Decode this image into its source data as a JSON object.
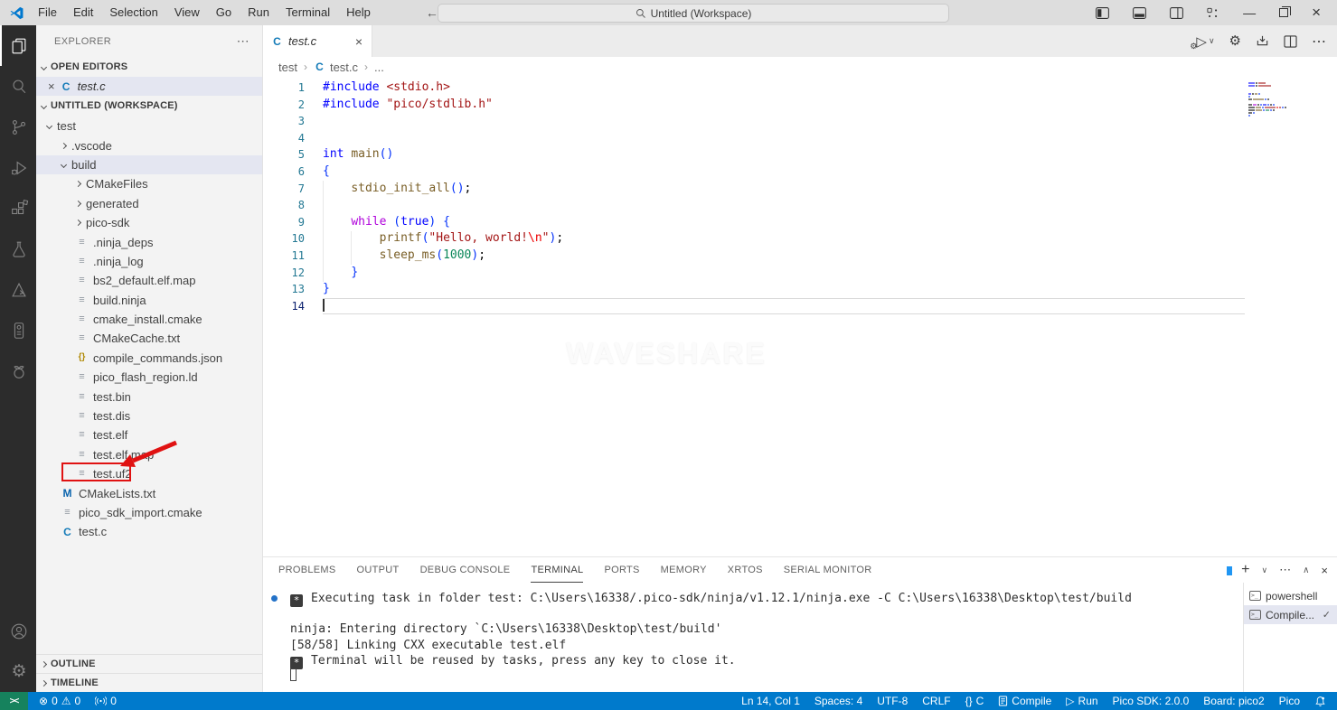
{
  "window": {
    "title_menus": [
      "File",
      "Edit",
      "Selection",
      "View",
      "Go",
      "Run",
      "Terminal",
      "Help"
    ],
    "search_label": "Untitled (Workspace)"
  },
  "activity_bar": {
    "items": [
      {
        "name": "explorer",
        "active": true
      },
      {
        "name": "search"
      },
      {
        "name": "source-control"
      },
      {
        "name": "run-and-debug"
      },
      {
        "name": "extensions"
      },
      {
        "name": "testing"
      },
      {
        "name": "cmake"
      },
      {
        "name": "pico-board"
      },
      {
        "name": "raspberry-pi-pico"
      }
    ],
    "bottom": [
      {
        "name": "accounts"
      },
      {
        "name": "settings"
      }
    ]
  },
  "sidebar": {
    "title": "EXPLORER",
    "sections": {
      "open_editors": "OPEN EDITORS",
      "workspace": "UNTITLED (WORKSPACE)",
      "outline": "OUTLINE",
      "timeline": "TIMELINE"
    },
    "open_editor_items": [
      {
        "label": "test.c",
        "icon": "c"
      }
    ],
    "tree": [
      {
        "label": "test",
        "type": "folder-open",
        "level": 0
      },
      {
        "label": ".vscode",
        "type": "folder",
        "level": 1
      },
      {
        "label": "build",
        "type": "folder-open",
        "level": 1,
        "selected": true
      },
      {
        "label": "CMakeFiles",
        "type": "folder",
        "level": 2
      },
      {
        "label": "generated",
        "type": "folder",
        "level": 2
      },
      {
        "label": "pico-sdk",
        "type": "folder",
        "level": 2
      },
      {
        "label": ".ninja_deps",
        "type": "file",
        "level": 2
      },
      {
        "label": ".ninja_log",
        "type": "file",
        "level": 2
      },
      {
        "label": "bs2_default.elf.map",
        "type": "file",
        "level": 2
      },
      {
        "label": "build.ninja",
        "type": "file",
        "level": 2
      },
      {
        "label": "cmake_install.cmake",
        "type": "file",
        "level": 2
      },
      {
        "label": "CMakeCache.txt",
        "type": "file",
        "level": 2
      },
      {
        "label": "compile_commands.json",
        "type": "json",
        "level": 2
      },
      {
        "label": "pico_flash_region.ld",
        "type": "file",
        "level": 2
      },
      {
        "label": "test.bin",
        "type": "file",
        "level": 2
      },
      {
        "label": "test.dis",
        "type": "file",
        "level": 2
      },
      {
        "label": "test.elf",
        "type": "file",
        "level": 2
      },
      {
        "label": "test.elf.map",
        "type": "file",
        "level": 2
      },
      {
        "label": "test.uf2",
        "type": "file",
        "level": 2,
        "annotated": true
      },
      {
        "label": "CMakeLists.txt",
        "type": "cmake",
        "level": 1
      },
      {
        "label": "pico_sdk_import.cmake",
        "type": "file",
        "level": 1
      },
      {
        "label": "test.c",
        "type": "c",
        "level": 1
      }
    ]
  },
  "editor": {
    "tab": {
      "label": "test.c",
      "icon": "c"
    },
    "breadcrumb": {
      "folder": "test",
      "file": "test.c",
      "symbol": "..."
    },
    "watermark": "WAVESHARE",
    "code": [
      {
        "n": 1,
        "segs": [
          [
            "kw",
            "#include"
          ],
          [
            "pl",
            " "
          ],
          [
            "str",
            "<stdio.h>"
          ]
        ]
      },
      {
        "n": 2,
        "segs": [
          [
            "kw",
            "#include"
          ],
          [
            "pl",
            " "
          ],
          [
            "str",
            "\"pico/stdlib.h\""
          ]
        ]
      },
      {
        "n": 3,
        "segs": []
      },
      {
        "n": 4,
        "segs": []
      },
      {
        "n": 5,
        "segs": [
          [
            "kw",
            "int"
          ],
          [
            "pl",
            " "
          ],
          [
            "fn",
            "main"
          ],
          [
            "brc",
            "()"
          ]
        ]
      },
      {
        "n": 6,
        "segs": [
          [
            "brc",
            "{"
          ]
        ]
      },
      {
        "n": 7,
        "segs": [
          [
            "pl",
            "    "
          ],
          [
            "fn",
            "stdio_init_all"
          ],
          [
            "brc",
            "()"
          ],
          [
            "pl",
            ";"
          ]
        ]
      },
      {
        "n": 8,
        "segs": []
      },
      {
        "n": 9,
        "segs": [
          [
            "pl",
            "    "
          ],
          [
            "ctrl",
            "while"
          ],
          [
            "pl",
            " "
          ],
          [
            "brc",
            "("
          ],
          [
            "kw",
            "true"
          ],
          [
            "brc",
            ")"
          ],
          [
            "pl",
            " "
          ],
          [
            "brc",
            "{"
          ]
        ]
      },
      {
        "n": 10,
        "segs": [
          [
            "pl",
            "        "
          ],
          [
            "fn",
            "printf"
          ],
          [
            "brc",
            "("
          ],
          [
            "str",
            "\"Hello, world!"
          ],
          [
            "esc",
            "\\n"
          ],
          [
            "str",
            "\""
          ],
          [
            "brc",
            ")"
          ],
          [
            "pl",
            ";"
          ]
        ]
      },
      {
        "n": 11,
        "segs": [
          [
            "pl",
            "        "
          ],
          [
            "fn",
            "sleep_ms"
          ],
          [
            "brc",
            "("
          ],
          [
            "num",
            "1000"
          ],
          [
            "brc",
            ")"
          ],
          [
            "pl",
            ";"
          ]
        ]
      },
      {
        "n": 12,
        "segs": [
          [
            "pl",
            "    "
          ],
          [
            "brc",
            "}"
          ]
        ]
      },
      {
        "n": 13,
        "segs": [
          [
            "brc",
            "}"
          ]
        ]
      },
      {
        "n": 14,
        "segs": [],
        "current": true
      }
    ]
  },
  "panel": {
    "tabs": [
      {
        "label": "PROBLEMS"
      },
      {
        "label": "OUTPUT"
      },
      {
        "label": "DEBUG CONSOLE"
      },
      {
        "label": "TERMINAL",
        "active": true
      },
      {
        "label": "PORTS"
      },
      {
        "label": "MEMORY"
      },
      {
        "label": "XRTOS"
      },
      {
        "label": "SERIAL MONITOR"
      }
    ],
    "terminal_lines": [
      {
        "dot": true,
        "badge": "*",
        "text": "Executing task in folder test: C:\\Users\\16338/.pico-sdk/ninja/v1.12.1/ninja.exe -C C:\\Users\\16338\\Desktop\\test/build"
      },
      {
        "text": ""
      },
      {
        "text": "ninja: Entering directory `C:\\Users\\16338\\Desktop\\test/build'"
      },
      {
        "text": "[58/58] Linking CXX executable test.elf"
      },
      {
        "badge": "*",
        "text": "Terminal will be reused by tasks, press any key to close it."
      },
      {
        "cursor": true,
        "text": ""
      }
    ],
    "terminal_list": [
      {
        "label": "powershell",
        "icon": "terminal"
      },
      {
        "label": "Compile...",
        "icon": "terminal",
        "check": true,
        "selected": true
      }
    ]
  },
  "status_bar": {
    "remote": "><",
    "errors": "0",
    "warnings": "0",
    "ports": "0",
    "line_col": "Ln 14, Col 1",
    "spaces": "Spaces: 4",
    "encoding": "UTF-8",
    "eol": "CRLF",
    "lang_braces": "{}",
    "language": "C",
    "compile": "Compile",
    "run": "Run",
    "sdk": "Pico SDK: 2.0.0",
    "board": "Board: pico2",
    "pico": "Pico"
  },
  "colors": {
    "accent": "#007acc",
    "remote_green": "#16825d",
    "annotation_red": "#e01212",
    "titlebar": "#dddddd",
    "activitybar": "#2c2c2c",
    "sidebar_bg": "#f3f3f3",
    "selection_bg": "#e4e6f1",
    "syntax": {
      "keyword": "#0000ff",
      "string": "#a31515",
      "function": "#795e26",
      "control": "#af00db",
      "number": "#098658",
      "escape": "#ee0000",
      "bracket": "#0431fa"
    }
  }
}
